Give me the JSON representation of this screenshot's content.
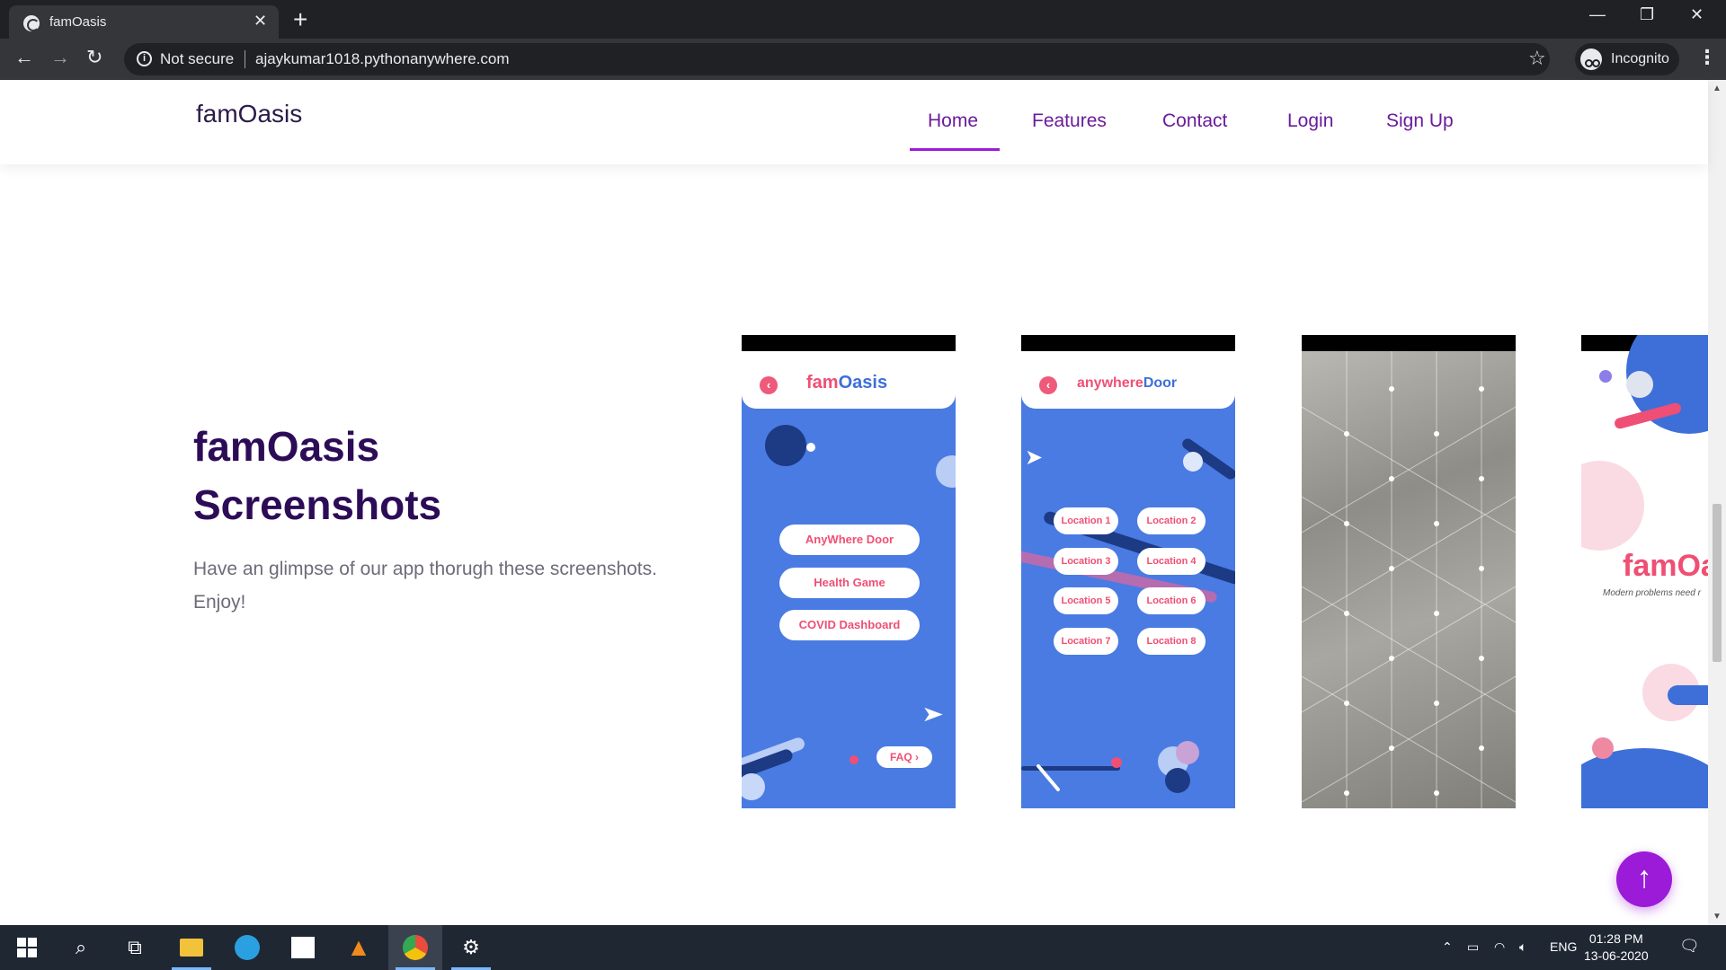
{
  "browser": {
    "tab_title": "famOasis",
    "tab_close": "✕",
    "new_tab": "+",
    "not_secure": "Not secure",
    "url": "ajaykumar1018.pythonanywhere.com",
    "incognito": "Incognito",
    "window_controls": {
      "minimize": "—",
      "restore": "❐",
      "close": "✕"
    },
    "icons": [
      "back-icon",
      "forward-icon",
      "reload-icon",
      "info-icon",
      "star-icon",
      "incognito-icon",
      "menu-icon"
    ]
  },
  "navbar": {
    "brand": "famOasis",
    "links": [
      {
        "label": "Home",
        "active": true
      },
      {
        "label": "Features",
        "active": false
      },
      {
        "label": "Contact",
        "active": false
      },
      {
        "label": "Login",
        "active": false
      },
      {
        "label": "Sign Up",
        "active": false
      }
    ]
  },
  "section": {
    "heading_line1": "famOasis",
    "heading_line2": "Screenshots",
    "subtext_line1": "Have an glimpse of our app thorugh these screenshots.",
    "subtext_line2": "Enjoy!"
  },
  "screenshots": {
    "shot1": {
      "title_a": "fam",
      "title_b": "Oasis",
      "buttons": [
        "AnyWhere Door",
        "Health Game",
        "COVID Dashboard"
      ],
      "faq": "FAQ ›"
    },
    "shot2": {
      "title_a": "anywhere",
      "title_b": "Door",
      "locations": [
        "Location 1",
        "Location 2",
        "Location 3",
        "Location 4",
        "Location 5",
        "Location 6",
        "Location 7",
        "Location 8"
      ]
    },
    "shot4": {
      "title_partial": "famOa",
      "tagline_partial": "Modern problems need r"
    }
  },
  "scroll_to_top": "↑",
  "taskbar": {
    "time": "01:28 PM",
    "date": "13-06-2020",
    "language": "ENG"
  },
  "colors": {
    "accent": "#9b1bd8",
    "heading": "#2d0c57",
    "app_blue": "#4a7be3",
    "app_pink": "#ef4f74"
  }
}
